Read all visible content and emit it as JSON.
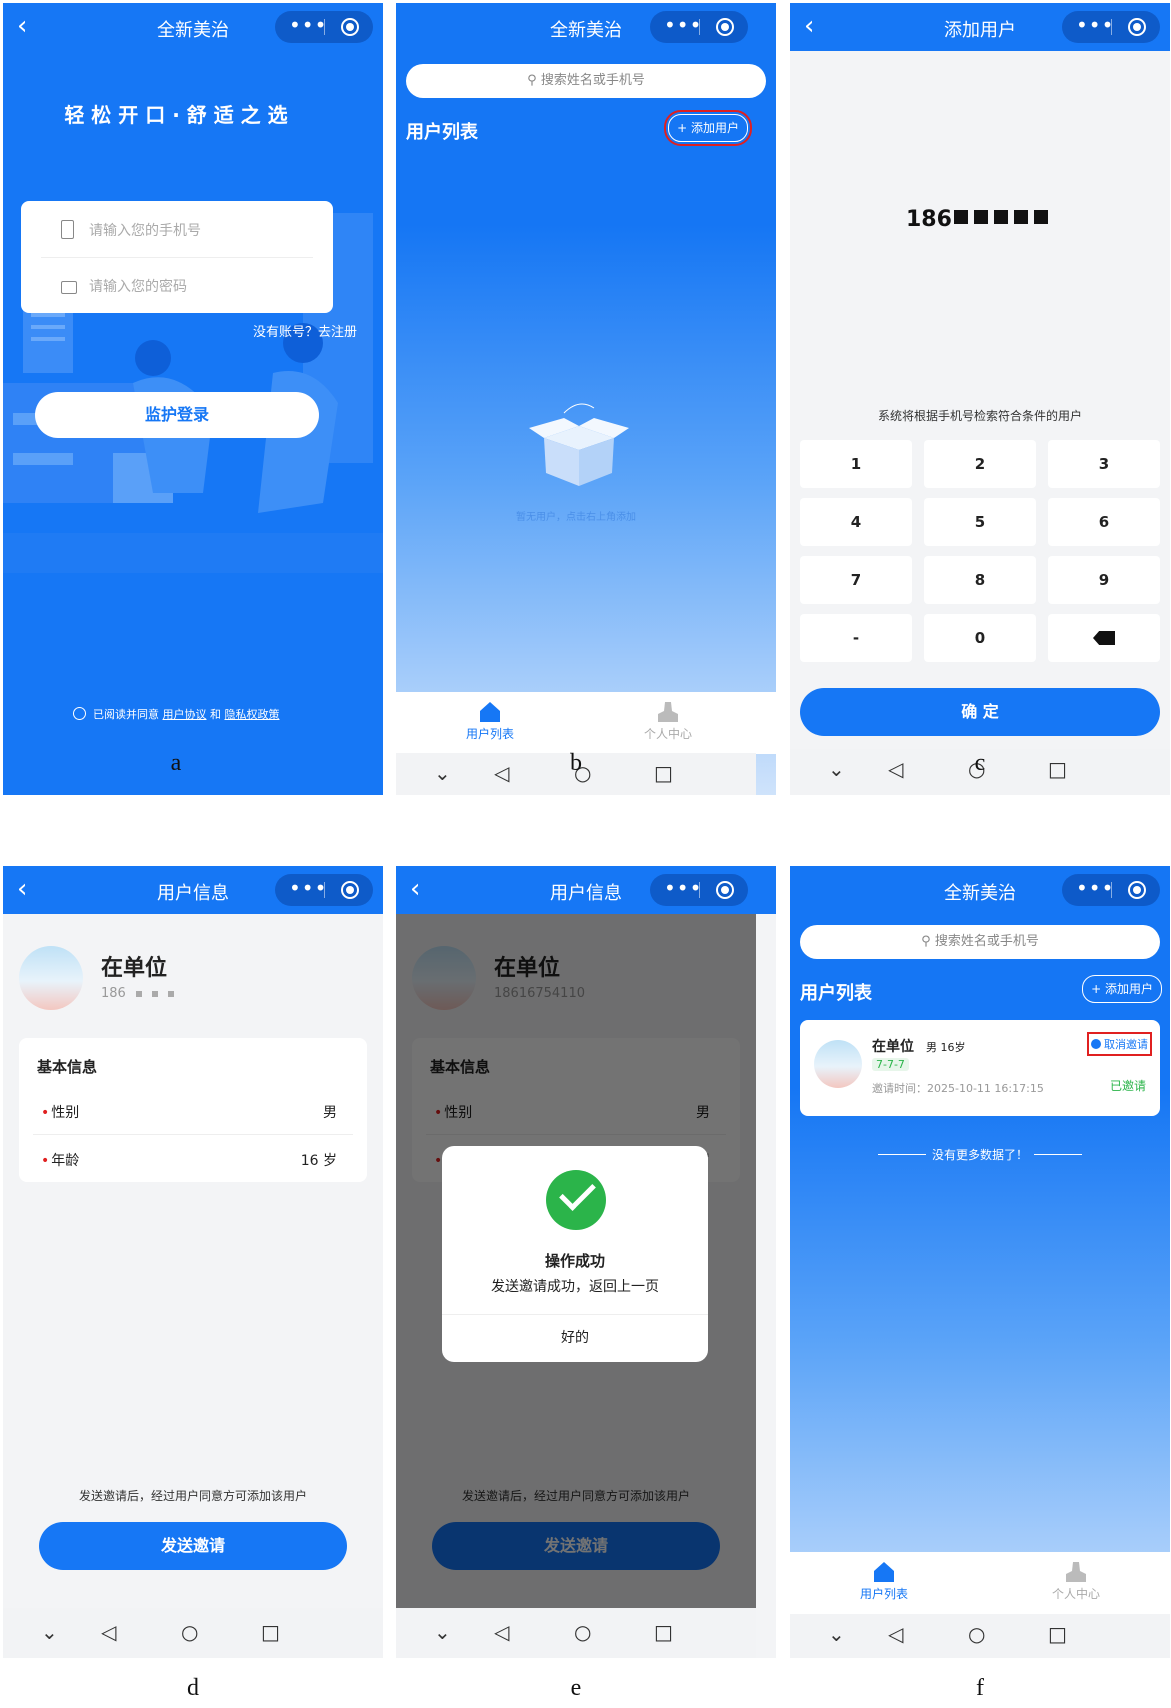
{
  "captions": [
    "a",
    "b",
    "c",
    "d",
    "e",
    "f"
  ],
  "app": {
    "title": "全新美治"
  },
  "login": {
    "slogan": "轻 松 开 口 · 舒 适 之 选",
    "phone_placeholder": "请输入您的手机号",
    "password_placeholder": "请输入您的密码",
    "register_link": "没有账号？去注册",
    "login_button": "监护登录",
    "agree_prefix": "已阅读并同意",
    "user_agreement": "用户协议",
    "and": "和",
    "privacy_policy": "隐私权政策"
  },
  "list": {
    "search_placeholder": "搜索姓名或手机号",
    "title": "用户列表",
    "add_user": "添加用户",
    "empty_text": "暂无用户，点击右上角添加",
    "no_more": "没有更多数据了！",
    "tabs": [
      "用户列表",
      "个人中心"
    ]
  },
  "add": {
    "title": "添加用户",
    "phone_display": "186",
    "hint": "系统将根据手机号检索符合条件的用户",
    "keys": [
      "1",
      "2",
      "3",
      "4",
      "5",
      "6",
      "7",
      "8",
      "9",
      "-",
      "0"
    ],
    "confirm": "确 定"
  },
  "info": {
    "title": "用户信息",
    "name": "在单位",
    "phone_masked": "186",
    "phone_full": "18616754110",
    "section": "基本信息",
    "gender_label": "性别",
    "gender_value": "男",
    "age_label": "年龄",
    "age_value": "16 岁",
    "note": "发送邀请后，经过用户同意方可添加该用户",
    "send_button": "发送邀请"
  },
  "dialog": {
    "title": "操作成功",
    "message": "发送邀请成功，返回上一页",
    "ok": "好的"
  },
  "invite_item": {
    "name": "在单位",
    "meta": "男 16岁",
    "tag": "7-7-7",
    "time_label": "邀请时间：",
    "time": "2025-10-11 16:17:15",
    "cancel": "取消邀请",
    "status": "已邀请"
  },
  "colors": {
    "primary": "#1677f5",
    "success": "#2bb44a",
    "danger": "#e02020"
  }
}
